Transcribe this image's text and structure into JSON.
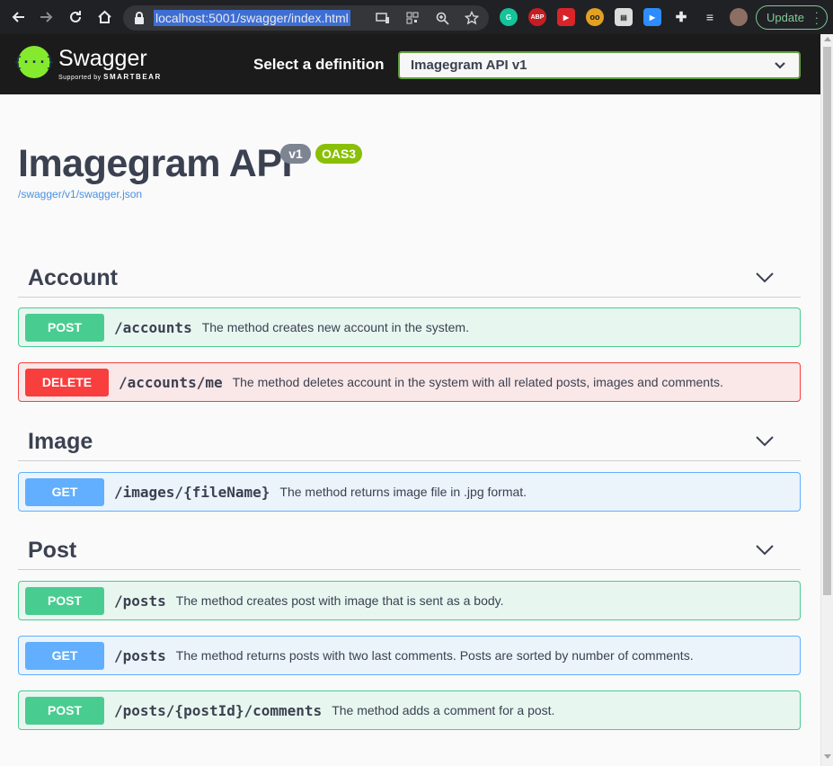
{
  "browser": {
    "url": "localhost:5001/swagger/index.html",
    "update_label": "Update",
    "extensions": [
      "grammarly-icon",
      "adblock-icon",
      "readlater-icon",
      "glasses-icon",
      "screenshot-icon",
      "zoom-icon",
      "puzzle-icon",
      "media-icon",
      "profile-avatar"
    ]
  },
  "topbar": {
    "logo_mark": "{···}",
    "logo_name": "Swagger",
    "logo_sub_prefix": "Supported by",
    "logo_sub_brand": "SMARTBEAR",
    "select_label": "Select a definition",
    "selected_definition": "Imagegram API v1"
  },
  "info": {
    "title": "Imagegram API",
    "version_badge": "v1",
    "oas_badge": "OAS3",
    "spec_url": "/swagger/v1/swagger.json"
  },
  "tags": [
    {
      "name": "Account",
      "operations": [
        {
          "method": "POST",
          "path": "/accounts",
          "summary": "The method creates new account in the system."
        },
        {
          "method": "DELETE",
          "path": "/accounts/me",
          "summary": "The method deletes account in the system with all related posts, images and comments."
        }
      ]
    },
    {
      "name": "Image",
      "operations": [
        {
          "method": "GET",
          "path": "/images/{fileName}",
          "summary": "The method returns image file in .jpg format."
        }
      ]
    },
    {
      "name": "Post",
      "operations": [
        {
          "method": "POST",
          "path": "/posts",
          "summary": "The method creates post with image that is sent as a body."
        },
        {
          "method": "GET",
          "path": "/posts",
          "summary": "The method returns posts with two last comments. Posts are sorted by number of comments."
        },
        {
          "method": "POST",
          "path": "/posts/{postId}/comments",
          "summary": "The method adds a comment for a post."
        }
      ]
    }
  ],
  "colors": {
    "post": "#49cc90",
    "get": "#61affe",
    "delete": "#f93e3e",
    "swagger_green": "#85ea2d",
    "topbar": "#1b1b1b"
  }
}
